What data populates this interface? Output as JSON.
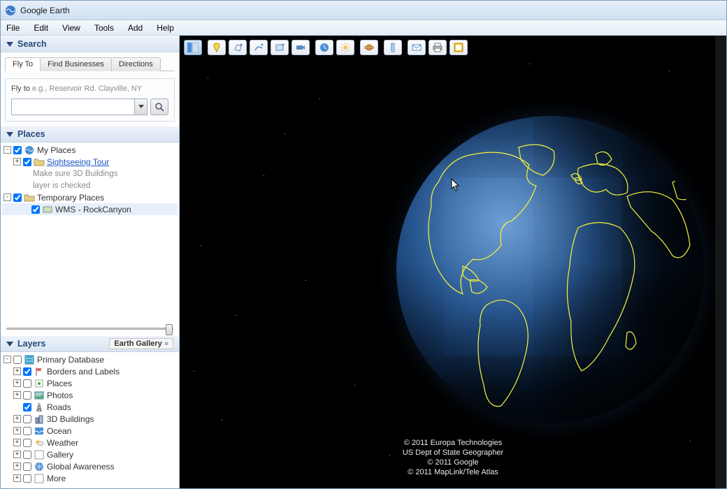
{
  "app": {
    "title": "Google Earth"
  },
  "menu": {
    "file": "File",
    "edit": "Edit",
    "view": "View",
    "tools": "Tools",
    "add": "Add",
    "help": "Help"
  },
  "search": {
    "title": "Search",
    "tabs": {
      "flyto": "Fly To",
      "find": "Find Businesses",
      "directions": "Directions"
    },
    "flyto_label": "Fly to",
    "flyto_eg": "e.g., Reservoir Rd. Clayville, NY",
    "value": ""
  },
  "places": {
    "title": "Places",
    "my_places": "My Places",
    "sightseeing": "Sightseeing Tour",
    "sightseeing_sub1": "Make sure 3D Buildings",
    "sightseeing_sub2": "layer is checked",
    "temporary": "Temporary Places",
    "wms": "WMS - RockCanyon"
  },
  "layers": {
    "title": "Layers",
    "gallery": "Earth Gallery",
    "primary": "Primary Database",
    "items": {
      "borders": "Borders and Labels",
      "places": "Places",
      "photos": "Photos",
      "roads": "Roads",
      "buildings": "3D Buildings",
      "ocean": "Ocean",
      "weather": "Weather",
      "gallery": "Gallery",
      "global": "Global Awareness",
      "more": "More"
    }
  },
  "toolbar": {
    "icons": [
      "panel",
      "placemark",
      "polygon",
      "path",
      "image",
      "tour",
      "clock",
      "sun",
      "planet",
      "ruler",
      "email",
      "print",
      "kml"
    ]
  },
  "attribution": {
    "l1": "© 2011 Europa Technologies",
    "l2": "US Dept of State Geographer",
    "l3": "© 2011 Google",
    "l4": "© 2011 MapLink/Tele Atlas"
  }
}
